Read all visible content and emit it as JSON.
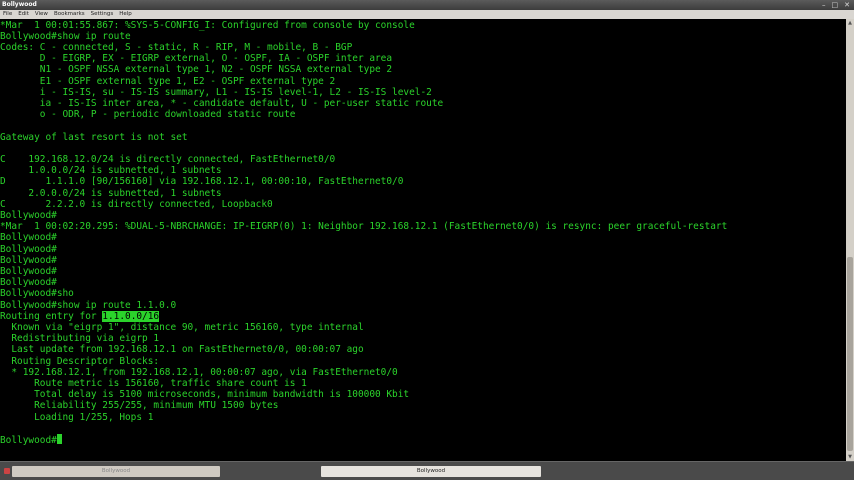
{
  "window": {
    "title": "Bollywood",
    "controls": [
      "minimize-icon",
      "maximize-icon",
      "close-icon"
    ]
  },
  "menu": [
    "File",
    "Edit",
    "View",
    "Bookmarks",
    "Settings",
    "Help"
  ],
  "terminal": {
    "lines": [
      "*Mar  1 00:01:55.867: %SYS-5-CONFIG_I: Configured from console by console",
      "Bollywood#show ip route",
      "Codes: C - connected, S - static, R - RIP, M - mobile, B - BGP",
      "       D - EIGRP, EX - EIGRP external, O - OSPF, IA - OSPF inter area",
      "       N1 - OSPF NSSA external type 1, N2 - OSPF NSSA external type 2",
      "       E1 - OSPF external type 1, E2 - OSPF external type 2",
      "       i - IS-IS, su - IS-IS summary, L1 - IS-IS level-1, L2 - IS-IS level-2",
      "       ia - IS-IS inter area, * - candidate default, U - per-user static route",
      "       o - ODR, P - periodic downloaded static route",
      "",
      "Gateway of last resort is not set",
      "",
      "C    192.168.12.0/24 is directly connected, FastEthernet0/0",
      "     1.0.0.0/24 is subnetted, 1 subnets",
      "D       1.1.1.0 [90/156160] via 192.168.12.1, 00:00:10, FastEthernet0/0",
      "     2.0.0.0/24 is subnetted, 1 subnets",
      "C       2.2.2.0 is directly connected, Loopback0",
      "Bollywood#",
      "*Mar  1 00:02:20.295: %DUAL-5-NBRCHANGE: IP-EIGRP(0) 1: Neighbor 192.168.12.1 (FastEthernet0/0) is resync: peer graceful-restart",
      "Bollywood#",
      "Bollywood#",
      "Bollywood#",
      "Bollywood#",
      "Bollywood#",
      "Bollywood#sho",
      "Bollywood#show ip route 1.1.0.0",
      "__ROUTING_ENTRY__",
      "  Known via \"eigrp 1\", distance 90, metric 156160, type internal",
      "  Redistributing via eigrp 1",
      "  Last update from 192.168.12.1 on FastEthernet0/0, 00:00:07 ago",
      "  Routing Descriptor Blocks:",
      "  * 192.168.12.1, from 192.168.12.1, 00:00:07 ago, via FastEthernet0/0",
      "      Route metric is 156160, traffic share count is 1",
      "      Total delay is 5100 microseconds, minimum bandwidth is 100000 Kbit",
      "      Reliability 255/255, minimum MTU 1500 bytes",
      "      Loading 1/255, Hops 1",
      "",
      "__PROMPT__"
    ],
    "routing_entry_prefix": "Routing entry for ",
    "routing_entry_highlight": "1.1.0.0/16",
    "prompt": "Bollywood#",
    "text_color": "#2bd32b",
    "background": "#000000"
  },
  "taskbar": {
    "tasks": [
      "Bollywood",
      "Bollywood"
    ]
  }
}
